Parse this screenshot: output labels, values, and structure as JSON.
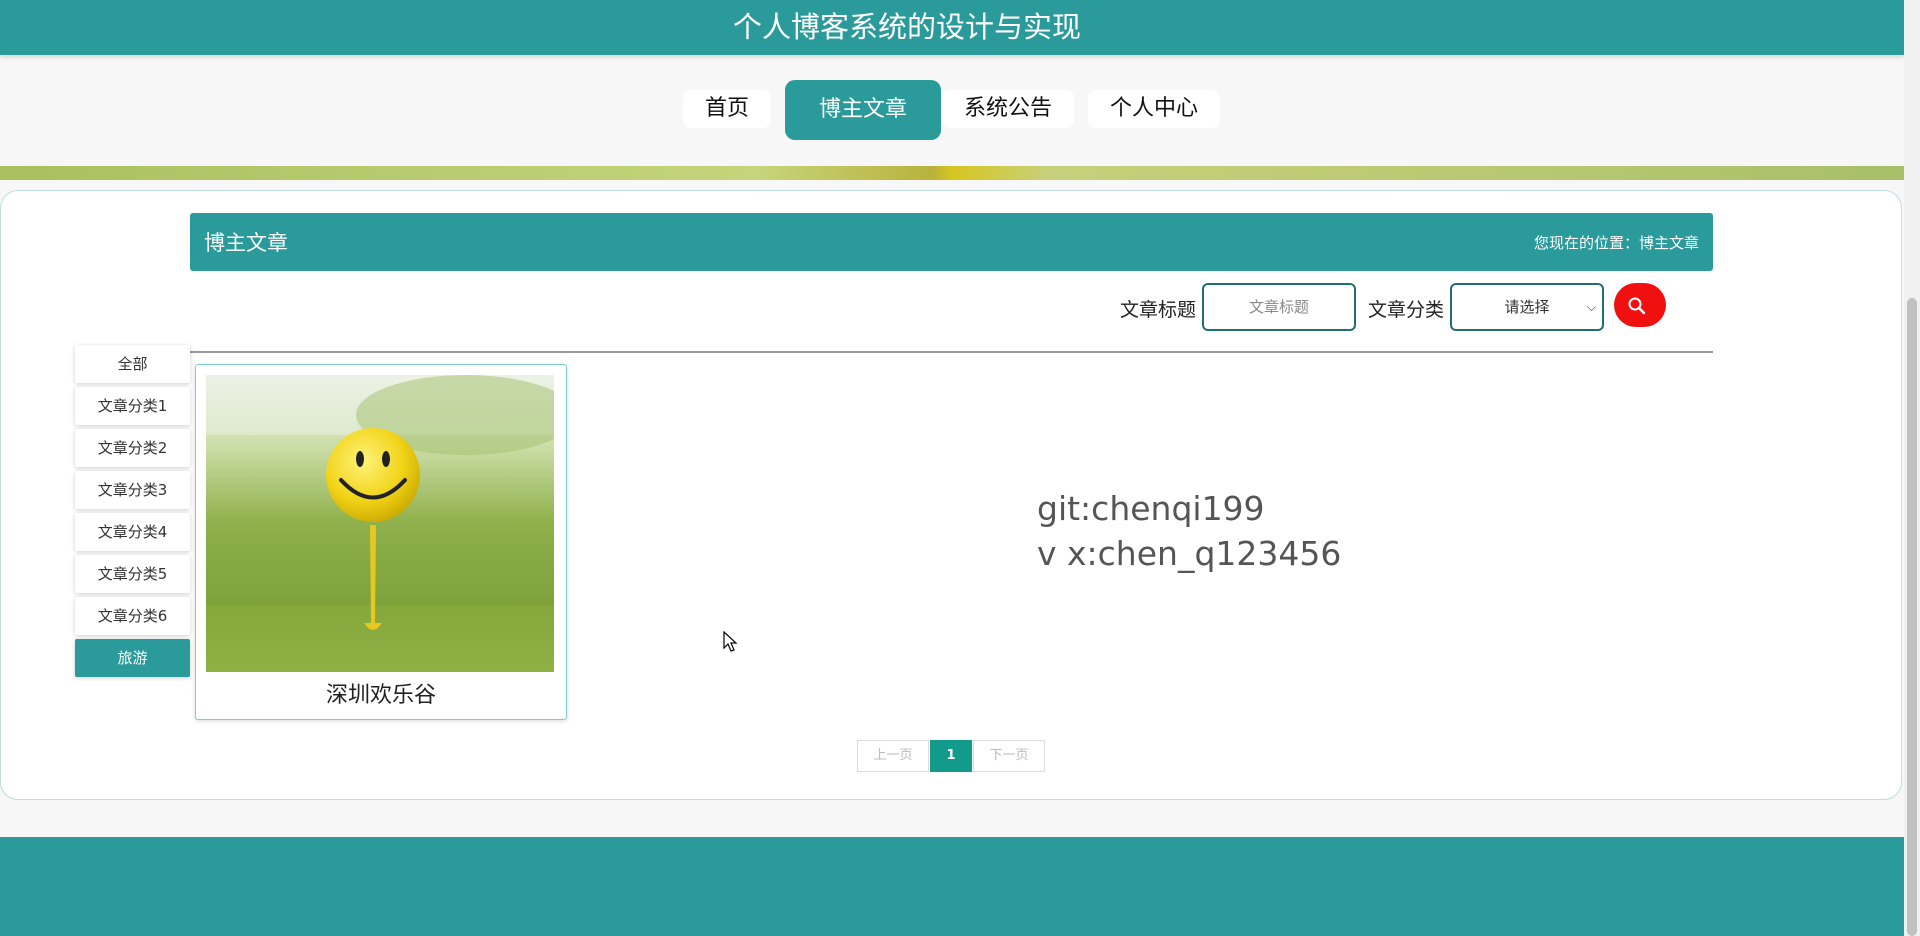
{
  "header": {
    "title": "个人博客系统的设计与实现"
  },
  "nav": {
    "items": [
      {
        "label": "首页"
      },
      {
        "label": "博主文章"
      },
      {
        "label": "系统公告"
      },
      {
        "label": "个人中心"
      }
    ],
    "active": "博主文章"
  },
  "section": {
    "title": "博主文章",
    "breadcrumb": "您现在的位置：博主文章"
  },
  "search": {
    "title_label": "文章标题",
    "title_placeholder": "文章标题",
    "category_label": "文章分类",
    "category_selected": "请选择",
    "button_label": "搜索"
  },
  "sidebar": {
    "items": [
      {
        "label": "全部"
      },
      {
        "label": "文章分类1"
      },
      {
        "label": "文章分类2"
      },
      {
        "label": "文章分类3"
      },
      {
        "label": "文章分类4"
      },
      {
        "label": "文章分类5"
      },
      {
        "label": "文章分类6"
      },
      {
        "label": "旅游"
      }
    ],
    "active": "旅游"
  },
  "articles": [
    {
      "title": "深圳欢乐谷",
      "image_icon": "smiley-golf-ball-image"
    }
  ],
  "info": {
    "line1": "git:chenqi199",
    "line2": "v x:chen_q123456"
  },
  "pagination": {
    "prev": "上一页",
    "current": "1",
    "next": "下一页"
  },
  "colors": {
    "primary": "#2a9a9a",
    "search_button": "#f01010",
    "page_current": "#129a8a"
  }
}
